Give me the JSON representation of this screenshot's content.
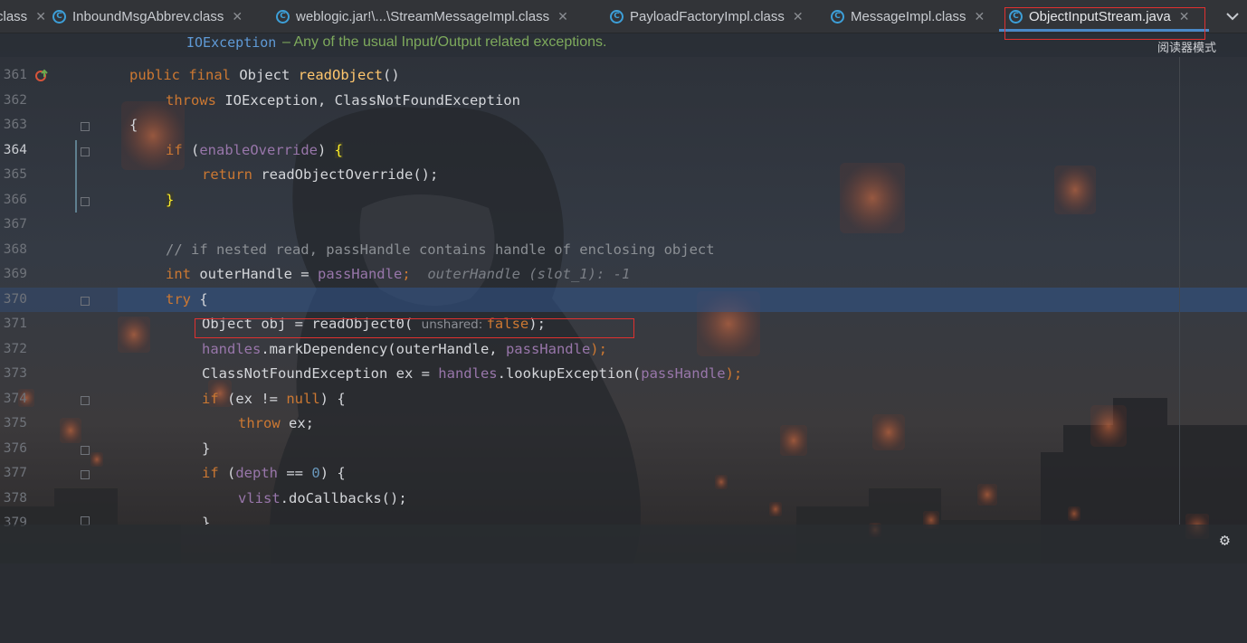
{
  "tabs": [
    {
      "label": "class",
      "icon": "",
      "active": false
    },
    {
      "label": "InboundMsgAbbrev.class",
      "icon": "class-file-icon",
      "active": false
    },
    {
      "label": "weblogic.jar!\\...\\StreamMessageImpl.class",
      "icon": "class-file-icon",
      "active": false
    },
    {
      "label": "PayloadFactoryImpl.class",
      "icon": "class-file-icon",
      "active": false
    },
    {
      "label": "MessageImpl.class",
      "icon": "class-file-icon",
      "active": false
    },
    {
      "label": "ObjectInputStream.java",
      "icon": "java-class-icon",
      "active": true
    }
  ],
  "doc": {
    "code": "IOException",
    "text": "– Any of the usual Input/Output related exceptions."
  },
  "reader_mode": "阅读器模式",
  "line_numbers": [
    "361",
    "362",
    "363",
    "364",
    "365",
    "366",
    "367",
    "368",
    "369",
    "370",
    "371",
    "372",
    "373",
    "374",
    "375",
    "376",
    "377",
    "378",
    "379"
  ],
  "code": {
    "l361": {
      "a": "public final ",
      "b": "Object ",
      "c": "readObject",
      "d": "()"
    },
    "l362": {
      "a": "throws ",
      "b": "IOException, ClassNotFoundException"
    },
    "l363": {
      "a": "{"
    },
    "l364": {
      "a": "if ",
      "b": "(",
      "c": "enableOverride",
      "d": ") ",
      "e": "{"
    },
    "l365": {
      "a": "return ",
      "b": "readObjectOverride",
      "c": "();"
    },
    "l366": {
      "a": "}"
    },
    "l368": {
      "a": "// if nested read, passHandle contains handle of enclosing object"
    },
    "l369": {
      "a": "int ",
      "b": "outerHandle = ",
      "c": "passHandle",
      "d": ";",
      "e": "outerHandle (slot_1): -1"
    },
    "l370": {
      "a": "try ",
      "b": "{"
    },
    "l371": {
      "a": "Object obj = readObject0( ",
      "b": "unshared: ",
      "c": "false",
      "d": ");"
    },
    "l372": {
      "a": "handles",
      "b": ".markDependency(outerHandle, ",
      "c": "passHandle",
      "d": ");"
    },
    "l373": {
      "a": "ClassNotFoundException ex = ",
      "b": "handles",
      "c": ".lookupException(",
      "d": "passHandle",
      "e": ");"
    },
    "l374": {
      "a": "if ",
      "b": "(ex != ",
      "c": "null",
      "d": ") {"
    },
    "l375": {
      "a": "throw ",
      "b": "ex;"
    },
    "l376": {
      "a": "}"
    },
    "l377": {
      "a": "if ",
      "b": "(",
      "c": "depth",
      "d": " == ",
      "e": "0",
      "f": ") {"
    },
    "l378": {
      "a": "vlist",
      "b": ".doCallbacks();"
    },
    "l379": {
      "a": "}"
    }
  },
  "colors": {
    "keyword": "#cc7832",
    "method": "#ffc66d",
    "field": "#9876aa",
    "comment": "#8b8f94",
    "number": "#6897bb",
    "highlight_box": "#e0312f"
  },
  "icons": {
    "settings": "gear-icon",
    "dropdown": "chevron-down-icon",
    "override": "override-marker-icon"
  }
}
